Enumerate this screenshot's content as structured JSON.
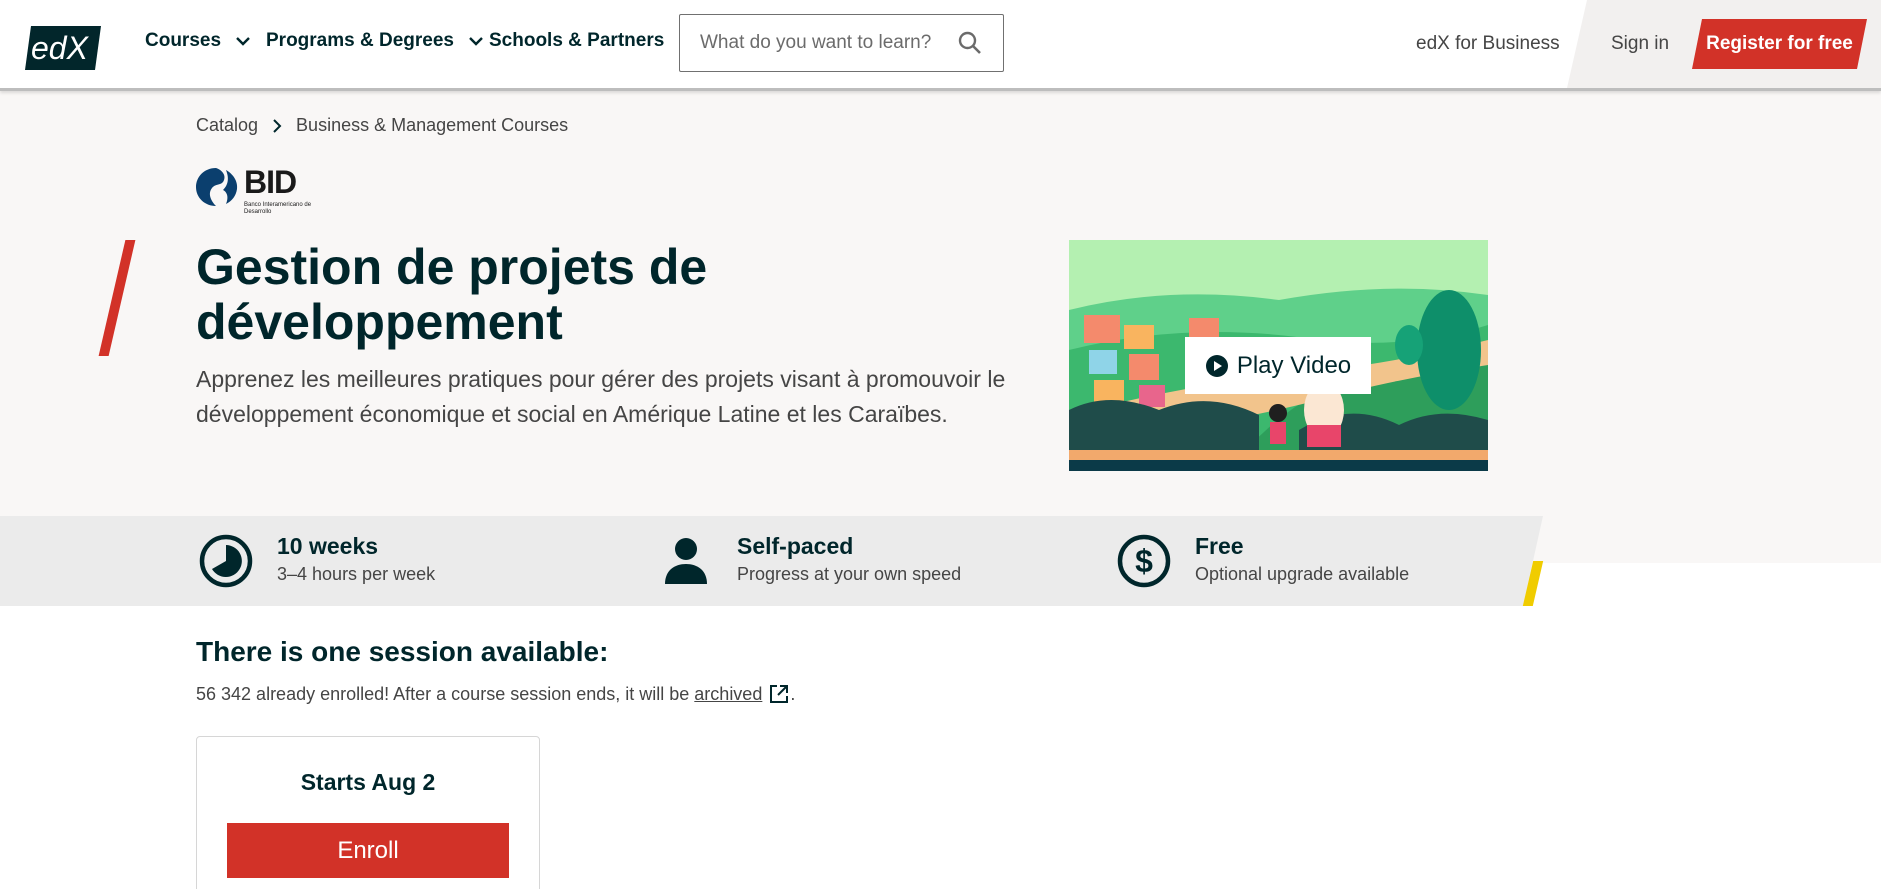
{
  "header": {
    "logo_text": "edX",
    "nav": [
      "Courses",
      "Programs & Degrees",
      "Schools & Partners"
    ],
    "search_placeholder": "What do you want to learn?",
    "business_link": "edX for Business",
    "sign_in": "Sign in",
    "register": "Register for free"
  },
  "breadcrumb": [
    "Catalog",
    "Business & Management Courses"
  ],
  "partner": {
    "name": "BID",
    "subtitle": "Banco Interamericano de Desarrollo"
  },
  "course": {
    "title": "Gestion de projets de développement",
    "subtitle": "Apprenez les meilleures pratiques pour gérer des projets visant à promouvoir le développement économique et social en Amérique Latine et les Caraïbes.",
    "play_video": "Play Video"
  },
  "facts": [
    {
      "icon": "clock-icon",
      "title": "10 weeks",
      "sub": "3–4 hours per week"
    },
    {
      "icon": "person-icon",
      "title": "Self-paced",
      "sub": "Progress at your own speed"
    },
    {
      "icon": "dollar-icon",
      "title": "Free",
      "sub": "Optional upgrade available"
    }
  ],
  "session": {
    "heading": "There is one session available:",
    "enrolled_text": "56 342 already enrolled! After a course session ends, it will be",
    "archived_link": "archived",
    "trailing": ".",
    "card_starts": "Starts Aug 2",
    "enroll": "Enroll"
  },
  "colors": {
    "brand_red": "#d23228",
    "accent_yellow": "#f0cc00",
    "text_dark": "#00262b",
    "hero_bg": "#f9f7f6"
  }
}
